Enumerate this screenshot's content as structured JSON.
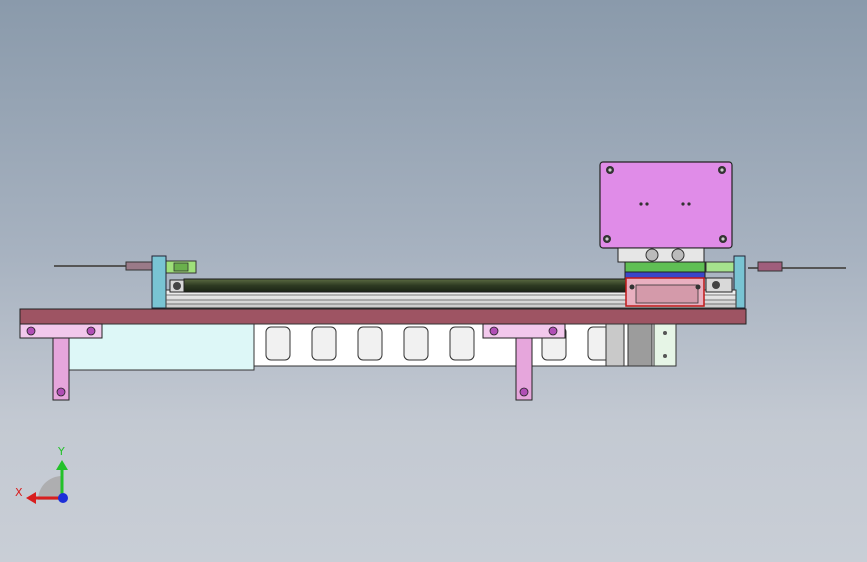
{
  "view": {
    "background_top": "#8a9aab",
    "background_bottom": "#c9ced6"
  },
  "triad": {
    "x_label": "X",
    "y_label": "Y",
    "x_color": "#d81e1e",
    "y_color": "#23c12a",
    "z_color": "#1d2fd8"
  },
  "colors": {
    "base_plate": "#9e5463",
    "motor": "#e08ce8",
    "screw_rod": "#3c4a2c",
    "carriage_green": "#5fbf54",
    "carriage_blue": "#3a45c8",
    "end_block": "#79c4d3",
    "bracket": "#e6a6dc",
    "pin": "#b04fb5",
    "guard": "#ddf7f7",
    "cable_chain": "#ffffff"
  },
  "parts": [
    "base-plate",
    "stepper-motor",
    "ball-screw",
    "linear-carriage",
    "left-end-block",
    "right-end-block",
    "cable-chain",
    "mount-bracket-left",
    "mount-bracket-middle",
    "side-guard",
    "proximity-sensor-left",
    "proximity-sensor-right"
  ]
}
